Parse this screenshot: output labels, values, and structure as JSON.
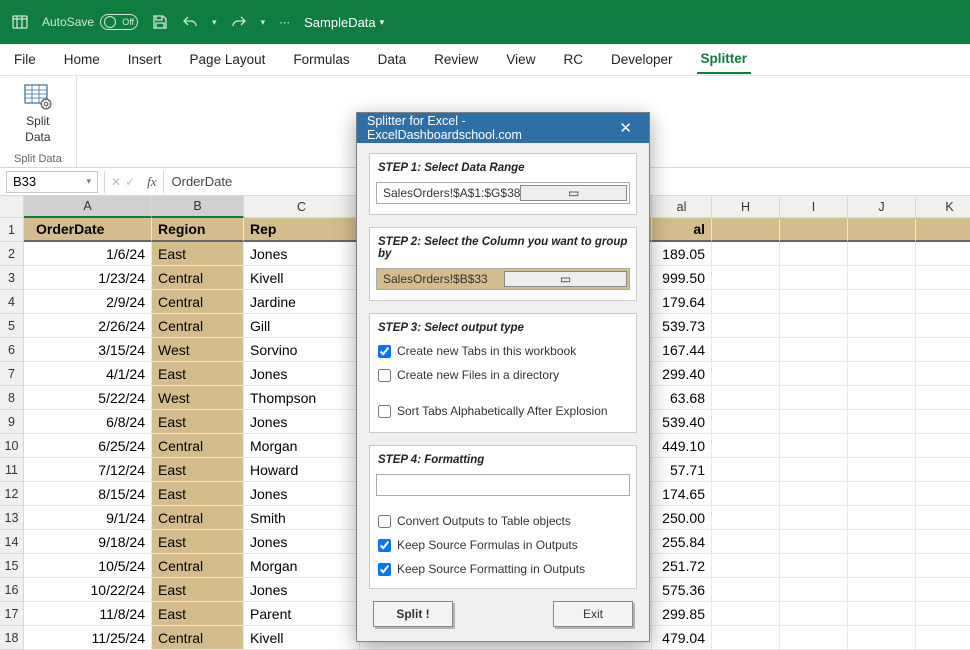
{
  "titlebar": {
    "autosave_label": "AutoSave",
    "autosave_state": "Off",
    "filename": "SampleData"
  },
  "menu": {
    "items": [
      "File",
      "Home",
      "Insert",
      "Page Layout",
      "Formulas",
      "Data",
      "Review",
      "View",
      "RC",
      "Developer",
      "Splitter"
    ],
    "active_index": 10
  },
  "ribbon": {
    "split_btn_line1": "Split",
    "split_btn_line2": "Data",
    "group_label": "Split Data"
  },
  "formula_bar": {
    "namebox": "B33",
    "formula": "OrderDate"
  },
  "grid": {
    "columns": [
      "A",
      "B",
      "C",
      "",
      "al",
      "H",
      "I",
      "J",
      "K"
    ],
    "selected_cols": [
      1,
      2
    ],
    "header_row": {
      "A": "OrderDate",
      "B": "Region",
      "C": "Rep",
      "E": "al"
    },
    "rows": [
      {
        "n": 2,
        "A": "1/6/24",
        "B": "East",
        "C": "Jones",
        "E": "189.05"
      },
      {
        "n": 3,
        "A": "1/23/24",
        "B": "Central",
        "C": "Kivell",
        "E": "999.50"
      },
      {
        "n": 4,
        "A": "2/9/24",
        "B": "Central",
        "C": "Jardine",
        "E": "179.64"
      },
      {
        "n": 5,
        "A": "2/26/24",
        "B": "Central",
        "C": "Gill",
        "E": "539.73"
      },
      {
        "n": 6,
        "A": "3/15/24",
        "B": "West",
        "C": "Sorvino",
        "E": "167.44"
      },
      {
        "n": 7,
        "A": "4/1/24",
        "B": "East",
        "C": "Jones",
        "E": "299.40"
      },
      {
        "n": 8,
        "A": "5/22/24",
        "B": "West",
        "C": "Thompson",
        "E": "63.68"
      },
      {
        "n": 9,
        "A": "6/8/24",
        "B": "East",
        "C": "Jones",
        "E": "539.40"
      },
      {
        "n": 10,
        "A": "6/25/24",
        "B": "Central",
        "C": "Morgan",
        "E": "449.10"
      },
      {
        "n": 11,
        "A": "7/12/24",
        "B": "East",
        "C": "Howard",
        "E": "57.71"
      },
      {
        "n": 12,
        "A": "8/15/24",
        "B": "East",
        "C": "Jones",
        "E": "174.65"
      },
      {
        "n": 13,
        "A": "9/1/24",
        "B": "Central",
        "C": "Smith",
        "E": "250.00"
      },
      {
        "n": 14,
        "A": "9/18/24",
        "B": "East",
        "C": "Jones",
        "E": "255.84"
      },
      {
        "n": 15,
        "A": "10/5/24",
        "B": "Central",
        "C": "Morgan",
        "E": "251.72"
      },
      {
        "n": 16,
        "A": "10/22/24",
        "B": "East",
        "C": "Jones",
        "E": "575.36"
      },
      {
        "n": 17,
        "A": "11/8/24",
        "B": "East",
        "C": "Parent",
        "E": "299.85"
      },
      {
        "n": 18,
        "A": "11/25/24",
        "B": "Central",
        "C": "Kivell",
        "E": "479.04"
      }
    ]
  },
  "dialog": {
    "title": "Splitter for Excel - ExcelDashboardschool.com",
    "step1_label": "STEP 1: Select Data Range",
    "step1_value": "SalesOrders!$A$1:$G$38",
    "step2_label": "STEP 2: Select the Column you want to group by",
    "step2_value": "SalesOrders!$B$33",
    "step3_label": "STEP 3: Select output type",
    "chk_newtabs": "Create new Tabs in this workbook",
    "chk_newfiles": "Create new Files in a directory",
    "chk_sort": "Sort Tabs Alphabetically After Explosion",
    "step4_label": "STEP 4: Formatting",
    "chk_tableobj": "Convert Outputs to Table objects",
    "chk_formulas": "Keep Source Formulas in Outputs",
    "chk_formatting": "Keep Source Formatting in Outputs",
    "btn_split": "Split !",
    "btn_exit": "Exit",
    "checked": {
      "newtabs": true,
      "newfiles": false,
      "sort": false,
      "tableobj": false,
      "formulas": true,
      "formatting": true
    }
  }
}
